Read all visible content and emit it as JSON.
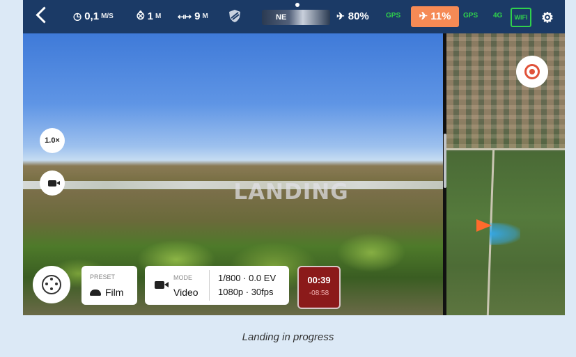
{
  "topbar": {
    "speed_value": "0,1",
    "speed_unit": "M/S",
    "altitude_value": "1",
    "altitude_unit": "M",
    "distance_value": "9",
    "distance_unit": "M",
    "heading_label": "NE",
    "drone_battery": "80%",
    "gps_label": "GPS",
    "controller_battery": "11%",
    "controller_gps_label": "GPS",
    "network_label": "4G",
    "wifi_label": "WIFI"
  },
  "camera": {
    "status_text": "LANDING",
    "zoom_label": "1.0×"
  },
  "bottom_bar": {
    "preset_caption": "PRESET",
    "preset_value": "Film",
    "mode_caption": "MODE",
    "mode_value": "Video",
    "exposure": "1/800 · 0.0 EV",
    "resolution": "1080p · 30fps",
    "record_elapsed": "00:39",
    "record_remaining": "-08:58"
  },
  "caption": "Landing in progress",
  "icons": {
    "back": "chevron-left-icon",
    "speed": "gauge-icon",
    "altitude": "altitude-icon",
    "distance": "distance-icon",
    "shield": "shield-icon",
    "drone_battery": "drone-battery-icon",
    "controller_battery": "controller-battery-icon",
    "settings": "gear-icon",
    "recenter": "target-icon",
    "camera_mode": "video-camera-icon",
    "joystick": "joystick-icon",
    "preset": "film-icon"
  },
  "colors": {
    "topbar": "#1b3a66",
    "warning": "#f58a55",
    "gps_green": "#30d04c",
    "record_red": "#8b1a1a",
    "drone_arrow": "#ff6a2c"
  }
}
